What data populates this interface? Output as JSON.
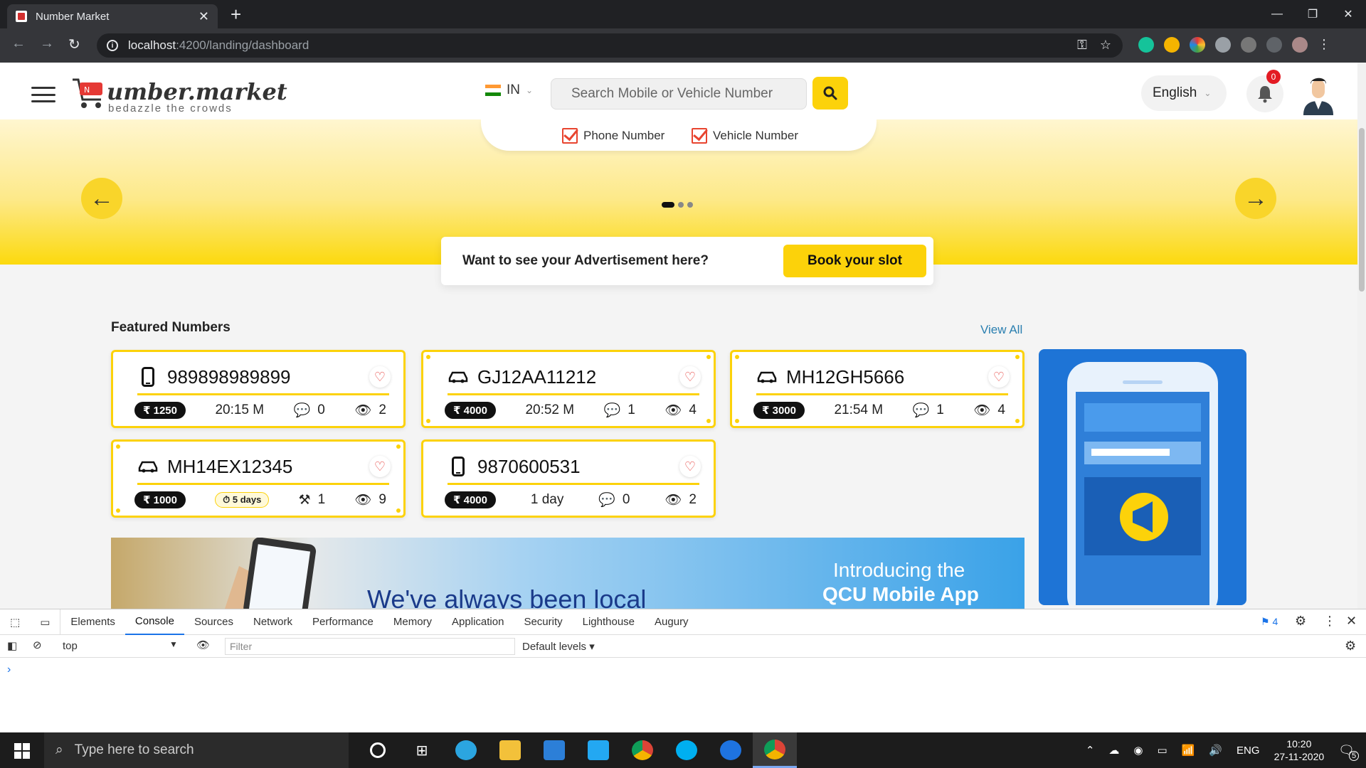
{
  "browser": {
    "tab_title": "Number Market",
    "url_host": "localhost",
    "url_path": ":4200/landing/dashboard"
  },
  "header": {
    "logo_text": "umber.market",
    "logo_tagline": "bedazzle the crowds",
    "country_code": "IN",
    "search_placeholder": "Search Mobile or Vehicle Number",
    "language": "English",
    "notification_count": "0"
  },
  "search_filters": {
    "phone_label": "Phone Number",
    "vehicle_label": "Vehicle Number"
  },
  "ad_banner": {
    "text": "Want to see your Advertisement here?",
    "button": "Book your slot"
  },
  "featured": {
    "title": "Featured Numbers",
    "view_all": "View All",
    "cards": [
      {
        "number": "989898989899",
        "price": "₹ 1250",
        "time": "20:15 M",
        "chats": "0",
        "views": "2"
      },
      {
        "number": "GJ12AA11212",
        "price": "₹ 4000",
        "time": "20:52 M",
        "chats": "1",
        "views": "4"
      },
      {
        "number": "MH12GH5666",
        "price": "₹ 3000",
        "time": "21:54 M",
        "chats": "1",
        "views": "4"
      },
      {
        "number": "MH14EX12345",
        "price": "₹ 1000",
        "time": "5 days",
        "bids": "1",
        "views": "9"
      },
      {
        "number": "9870600531",
        "price": "₹ 4000",
        "time": "1 day",
        "chats": "0",
        "views": "2"
      }
    ]
  },
  "bottom_banner": {
    "line1": "We've always been local",
    "line2": "Introducing the",
    "line3": "QCU Mobile App"
  },
  "devtools": {
    "tabs": [
      "Elements",
      "Console",
      "Sources",
      "Network",
      "Performance",
      "Memory",
      "Application",
      "Security",
      "Lighthouse",
      "Augury"
    ],
    "issues_count": "4",
    "context": "top",
    "filter_placeholder": "Filter",
    "levels": "Default levels"
  },
  "taskbar": {
    "search_placeholder": "Type here to search",
    "lang": "ENG",
    "time": "10:20",
    "date": "27-11-2020",
    "notif_count": "5"
  }
}
